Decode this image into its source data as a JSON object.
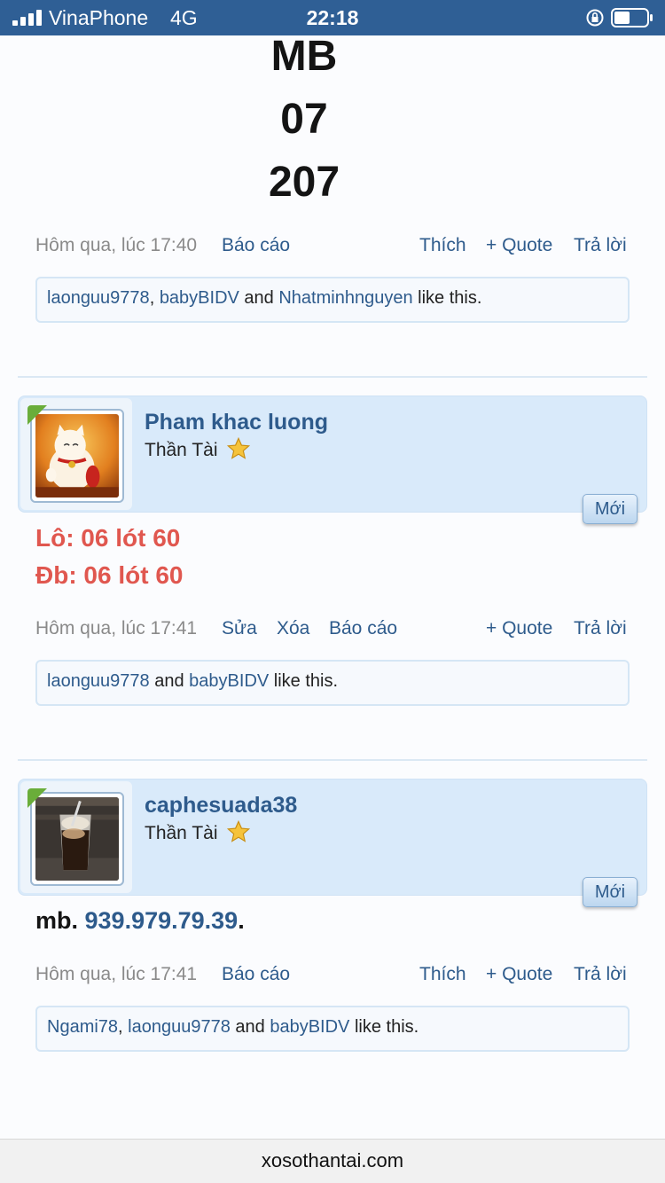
{
  "status": {
    "carrier": "VinaPhone",
    "network": "4G",
    "time": "22:18"
  },
  "top_post": {
    "lines": [
      "MB",
      "07",
      "207"
    ],
    "meta": {
      "time": "Hôm qua, lúc 17:40",
      "report": "Báo cáo",
      "like": "Thích",
      "quote": "+ Quote",
      "reply": "Trả lời"
    },
    "likes": {
      "users": [
        "laonguu9778",
        "babyBIDV",
        "Nhatminhnguyen"
      ],
      "sep1": ", ",
      "sep2": " and ",
      "suffix": " like this."
    }
  },
  "post2": {
    "username": "Pham khac luong",
    "rank": "Thần Tài",
    "badge": "Mới",
    "lines": [
      "Lô: 06 lót 60",
      "Đb: 06 lót 60"
    ],
    "meta": {
      "time": "Hôm qua, lúc 17:41",
      "edit": "Sửa",
      "delete": "Xóa",
      "report": "Báo cáo",
      "quote": "+ Quote",
      "reply": "Trả lời"
    },
    "likes": {
      "users": [
        "laonguu9778",
        "babyBIDV"
      ],
      "sep": " and ",
      "suffix": " like this."
    }
  },
  "post3": {
    "username": "caphesuada38",
    "rank": "Thần Tài",
    "badge": "Mới",
    "text_prefix": "mb. ",
    "text_number": "939.979.79.39",
    "text_suffix": ".",
    "meta": {
      "time": "Hôm qua, lúc 17:41",
      "report": "Báo cáo",
      "like": "Thích",
      "quote": "+ Quote",
      "reply": "Trả lời"
    },
    "likes": {
      "users": [
        "Ngami78",
        "laonguu9778",
        "babyBIDV"
      ],
      "sep1": ", ",
      "sep2": " and ",
      "suffix": " like this."
    }
  },
  "footer": {
    "domain": "xosothantai.com"
  }
}
